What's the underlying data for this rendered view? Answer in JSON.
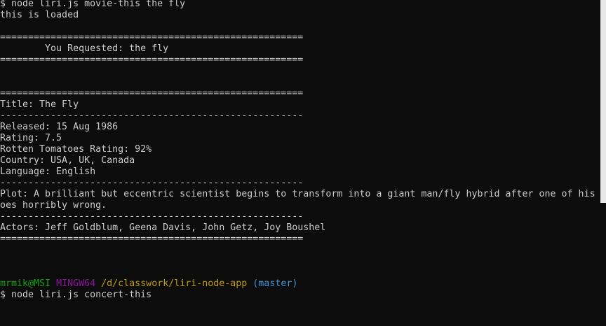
{
  "terminal": {
    "lines": [
      "$ node liri.js movie-this the fly",
      "this is loaded",
      "",
      "======================================================",
      "        You Requested: the fly",
      "======================================================",
      "",
      "",
      "======================================================",
      "Title: The Fly",
      "------------------------------------------------------",
      "Released: 15 Aug 1986",
      "Rating: 7.5",
      "Rotten Tomatoes Rating: 92%",
      "Country: USA, UK, Canada",
      "Language: English",
      "------------------------------------------------------",
      "Plot: A brilliant but eccentric scientist begins to transform into a giant man/fly hybrid after one of his ex",
      "oes horribly wrong.",
      "------------------------------------------------------",
      "Actors: Jeff Goldblum, Geena Davis, John Getz, Joy Boushel",
      "======================================================",
      "",
      "",
      ""
    ],
    "prompt": {
      "user": "mrmik@MSI",
      "system": "MINGW64",
      "path": "/d/classwork/liri-node-app",
      "branch": "(master)"
    },
    "current_command": "$ node liri.js concert-this"
  },
  "colors": {
    "background": "#0c0c0c",
    "text": "#cccccc",
    "user": "#13a10e",
    "system": "#881798",
    "path": "#c19c00",
    "branch": "#3a96dd"
  }
}
